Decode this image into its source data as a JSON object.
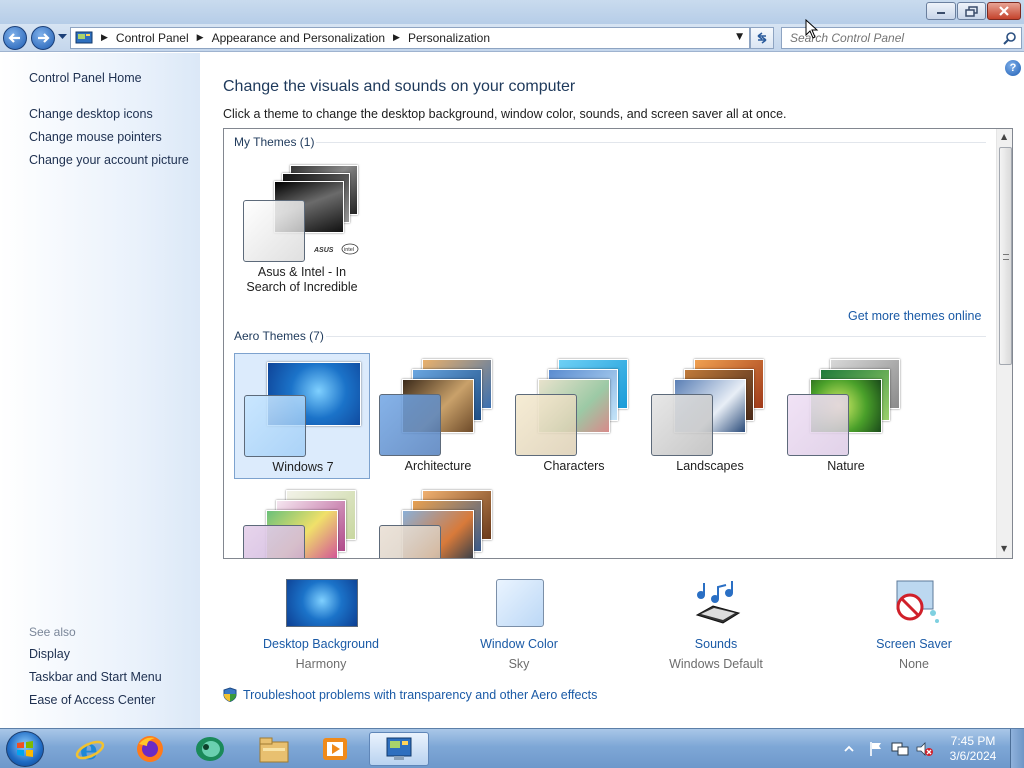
{
  "window": {
    "caption_buttons": [
      "minimize",
      "restore",
      "close"
    ]
  },
  "nav": {
    "breadcrumb": [
      "Control Panel",
      "Appearance and Personalization",
      "Personalization"
    ],
    "search_placeholder": "Search Control Panel"
  },
  "sidebar": {
    "home": "Control Panel Home",
    "tasks": [
      "Change desktop icons",
      "Change mouse pointers",
      "Change your account picture"
    ],
    "see_also_label": "See also",
    "see_also": [
      "Display",
      "Taskbar and Start Menu",
      "Ease of Access Center"
    ]
  },
  "main": {
    "help": "?",
    "heading": "Change the visuals and sounds on your computer",
    "subheading": "Click a theme to change the desktop background, window color, sounds, and screen saver all at once.",
    "my_themes_label": "My Themes (1)",
    "my_themes": [
      {
        "name": "Asus & Intel - In Search of Incredible",
        "line1": "Asus & Intel - In",
        "line2": "Search of Incredible"
      }
    ],
    "more_link": "Get more themes online",
    "aero_label": "Aero Themes (7)",
    "aero_themes": [
      "Windows 7",
      "Architecture",
      "Characters",
      "Landscapes",
      "Nature",
      "",
      ""
    ],
    "selected_theme": "Windows 7",
    "settings": [
      {
        "name": "Desktop Background",
        "value": "Harmony"
      },
      {
        "name": "Window Color",
        "value": "Sky"
      },
      {
        "name": "Sounds",
        "value": "Windows Default"
      },
      {
        "name": "Screen Saver",
        "value": "None"
      }
    ],
    "troubleshoot": "Troubleshoot problems with transparency and other Aero effects"
  },
  "taskbar": {
    "pinned": [
      "internet-explorer-icon",
      "firefox-icon",
      "app-icon",
      "windows-explorer-icon",
      "media-player-icon",
      "control-panel-icon"
    ],
    "time": "7:45 PM",
    "date": "3/6/2024"
  },
  "colors": {
    "link": "#1a5aa6",
    "heading": "#1e395b",
    "selection": "#dcebfc"
  }
}
